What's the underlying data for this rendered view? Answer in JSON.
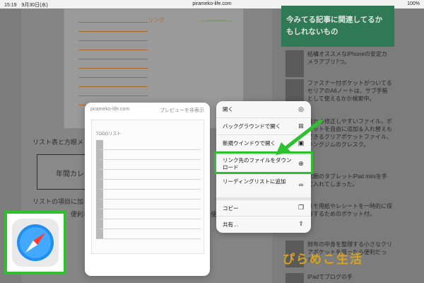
{
  "status": {
    "time_date": "15:19　9月30日(水)",
    "url": "pirameko-life.com",
    "battery": "100%"
  },
  "background": {
    "link_note": "リンク",
    "text1": "リスト表と方眼メ",
    "box_label": "年間カレ",
    "text2": "リストの項目に加",
    "text3": "便利な",
    "text4": "使"
  },
  "sidebar": {
    "heading": "今みてる記事に関連してるかもしれないもの",
    "items": [
      "結構オススメなiPhoneの安定カメラアプリ7つ。",
      "ファスナー付ポケットがついてるセリアのA6ノートは、サブ手帳として使えるかか検索中。",
      "後から修正しやすいファイル。ポケットを自由に追加＆入れ替えもできるクリアポケットファイル、キングジムのクレスク。",
      "念願のタブレットiPad miniを手に入れてしまった。",
      "メモ用紙やレシートを一時的に保存するためのポケット付。",
      "財布の中身を整理する小さなクリアポケットを買ったら便利だった。",
      "iPadでブログの手"
    ]
  },
  "preview": {
    "url": "pirameko-life.com",
    "hide_label": "プレビューを非表示",
    "doc_title": "TODOリスト"
  },
  "menu": {
    "items": [
      {
        "label": "開く",
        "icon": "compass-icon"
      },
      {
        "label": "バックグラウンドで開く",
        "icon": "plus-square-icon"
      },
      {
        "label": "新規ウインドウで開く",
        "icon": "window-icon"
      },
      {
        "label": "リンク先のファイルをダウンロード",
        "icon": "download-icon"
      },
      {
        "label": "リーディングリストに追加",
        "icon": "glasses-icon"
      },
      {
        "label": "コピー",
        "icon": "copy-icon"
      },
      {
        "label": "共有…",
        "icon": "share-icon"
      }
    ]
  },
  "watermark": "ぴらめこ生活",
  "colors": {
    "highlight": "#2ec02e",
    "sidebar_head": "#2f7a55",
    "orange_note": "#b3692a"
  }
}
